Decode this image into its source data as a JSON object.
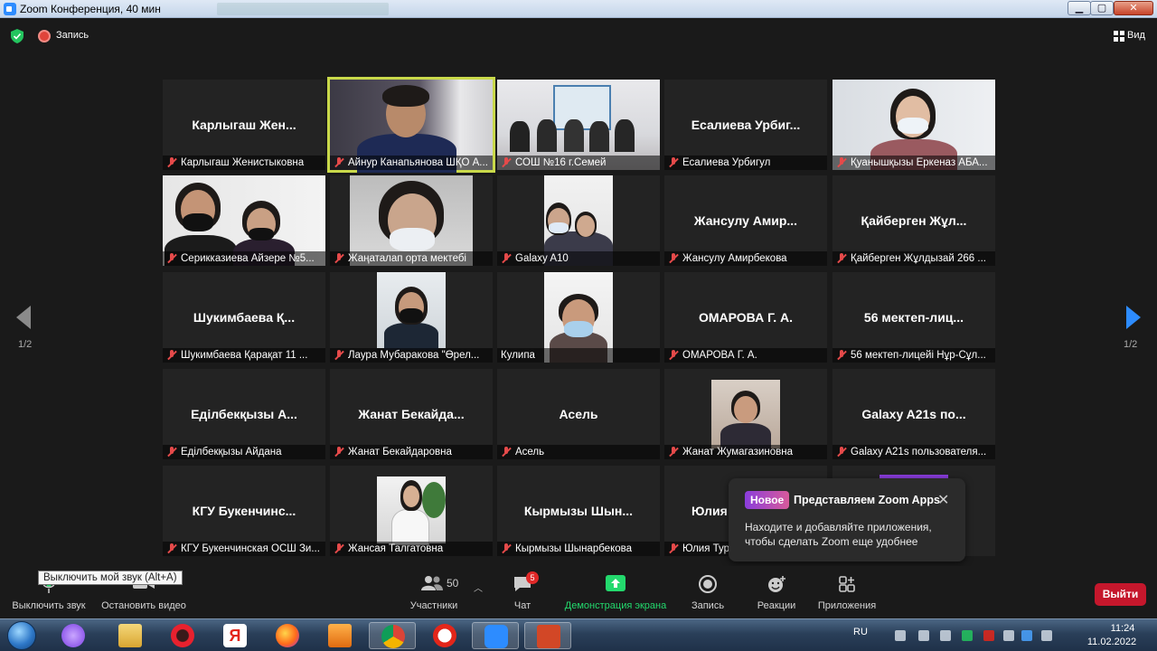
{
  "window": {
    "title": "Zoom Конференция, 40 мин"
  },
  "topbar": {
    "recording_label": "Запись",
    "view_label": "Вид"
  },
  "pagination": {
    "left": "1/2",
    "right": "1/2"
  },
  "tiles": [
    {
      "name": "Карлыгаш Женистыковна",
      "big": "Карлыгаш  Жен..."
    },
    {
      "name": "Айнур Канапьянова  ШҚО А...",
      "big": ""
    },
    {
      "name": "СОШ №16 г.Семей",
      "big": ""
    },
    {
      "name": "Есалиева Урбигул",
      "big": "Есалиева  Урбиг..."
    },
    {
      "name": "Қуанышқызы Еркеназ АБА...",
      "big": ""
    },
    {
      "name": "Серикказиева Айзере №5...",
      "big": ""
    },
    {
      "name": "Жаңаталап орта мектебі",
      "big": ""
    },
    {
      "name": "Galaxy A10",
      "big": ""
    },
    {
      "name": "Жансулу Амирбекова",
      "big": "Жансулу  Амир..."
    },
    {
      "name": "Қайберген Жұлдызай 266 ...",
      "big": "Қайберген  Жұл..."
    },
    {
      "name": "Шукимбаева Қарақат 11 ...",
      "big": "Шукимбаева  Қ..."
    },
    {
      "name": "Лаура Мубаракова \"Өрел...",
      "big": ""
    },
    {
      "name": "Кулипа",
      "big": ""
    },
    {
      "name": "ОМАРОВА Г. А.",
      "big": "ОМАРОВА  Г. А."
    },
    {
      "name": "56 мектеп-лицейі Нұр-Сұл...",
      "big": "56  мектеп-лиц..."
    },
    {
      "name": "Еділбекқызы Айдана",
      "big": "Еділбекқызы  А..."
    },
    {
      "name": "Жанат Бекайдаровна",
      "big": "Жанат  Бекайда..."
    },
    {
      "name": "Асель",
      "big": "Асель"
    },
    {
      "name": "Жанат Жумагазиновна",
      "big": ""
    },
    {
      "name": "Galaxy A21s пользователя...",
      "big": "Galaxy  A21s  по..."
    },
    {
      "name": "КГУ Букенчинская ОСШ Зи...",
      "big": "КГУ  Букенчинс..."
    },
    {
      "name": "Жансая Талгатовна",
      "big": ""
    },
    {
      "name": "Кырмызы Шынарбекова",
      "big": "Кырмызы  Шын..."
    },
    {
      "name": "Юлия Тур",
      "big": "Юлия"
    },
    {
      "name": "",
      "big": ""
    }
  ],
  "popup": {
    "badge": "Новое",
    "title": "Представляем Zoom Apps",
    "close": "✕",
    "body": "Находите и добавляйте приложения, чтобы сделать Zoom еще удобнее"
  },
  "tooltip": "Выключить мой звук (Alt+A)",
  "toolbar": {
    "mute": "Выключить звук",
    "video": "Остановить видео",
    "participants": "Участники",
    "participants_count": "50",
    "chat": "Чат",
    "chat_badge": "5",
    "share": "Демонстрация экрана",
    "record": "Запись",
    "reactions": "Реакции",
    "apps": "Приложения",
    "leave": "Выйти"
  },
  "taskbar": {
    "lang": "RU",
    "time": "11:24",
    "date": "11.02.2022",
    "icon_names": [
      "start-orb-icon",
      "alice-icon",
      "file-explorer-icon",
      "opera-icon",
      "yandex-icon",
      "firefox-icon",
      "media-player-icon",
      "chrome-icon",
      "yandex-browser-icon",
      "zoom-icon",
      "powerpoint-icon"
    ]
  },
  "colors": {
    "accent": "#2d8cff",
    "share_green": "#23d96d",
    "leave_red": "#c5172c",
    "active_speaker": "#c9d94a"
  }
}
